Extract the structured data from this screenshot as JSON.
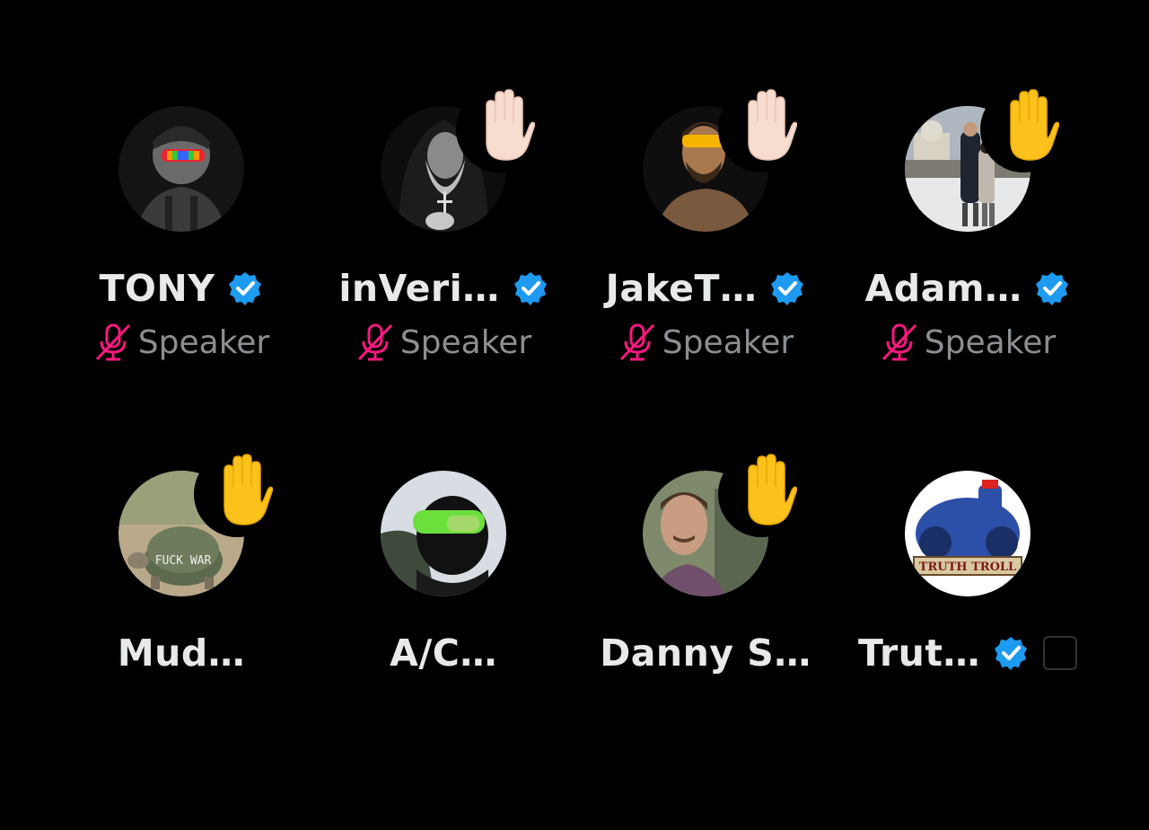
{
  "colors": {
    "background": "#000000",
    "name_text": "#e7e9ea",
    "role_text": "#8b8f93",
    "verified_blue": "#1d9bf0",
    "muted_mic_pink": "#f91880"
  },
  "speakers": [
    {
      "name": "TONY",
      "role": "Speaker",
      "verified": true,
      "muted": true,
      "hand_raised": false
    },
    {
      "name": "inVeri…",
      "role": "Speaker",
      "verified": true,
      "muted": true,
      "hand_raised": true,
      "hand_skin": "light"
    },
    {
      "name": "JakeT…",
      "role": "Speaker",
      "verified": true,
      "muted": true,
      "hand_raised": true,
      "hand_skin": "light"
    },
    {
      "name": "Adam…",
      "role": "Speaker",
      "verified": true,
      "muted": true,
      "hand_raised": true,
      "hand_skin": "yellow"
    },
    {
      "name": "Mud…",
      "role": "",
      "verified": false,
      "hand_raised": true,
      "hand_skin": "yellow"
    },
    {
      "name": "A/C…",
      "role": "",
      "verified": false,
      "hand_raised": false
    },
    {
      "name": "Danny S…",
      "role": "",
      "verified": false,
      "hand_raised": true,
      "hand_skin": "yellow"
    },
    {
      "name": "Trut…",
      "role": "",
      "verified": true,
      "hand_raised": false
    }
  ],
  "avatar_texts": {
    "mud": "FUCK WAR",
    "truth": "TRUTH TROLL"
  },
  "icons": {
    "verified": "verified-badge-icon",
    "muted": "mic-muted-icon",
    "hand": "raised-hand-icon"
  }
}
